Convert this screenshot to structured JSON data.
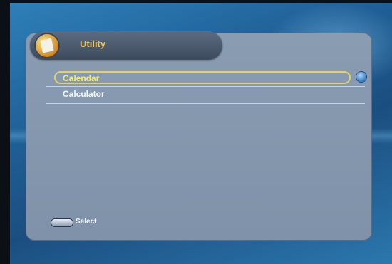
{
  "header": {
    "title": "Utility"
  },
  "menu": {
    "items": [
      {
        "label": "Calendar",
        "selected": true
      },
      {
        "label": "Calculator",
        "selected": false
      }
    ]
  },
  "footer": {
    "hint_label": "Select",
    "hint_key_icon": "ok-button-icon"
  },
  "colors": {
    "selected_text": "#f2e96a",
    "title_text": "#f0c048",
    "panel": "#8a9cb2",
    "background": "#1f5f96"
  }
}
